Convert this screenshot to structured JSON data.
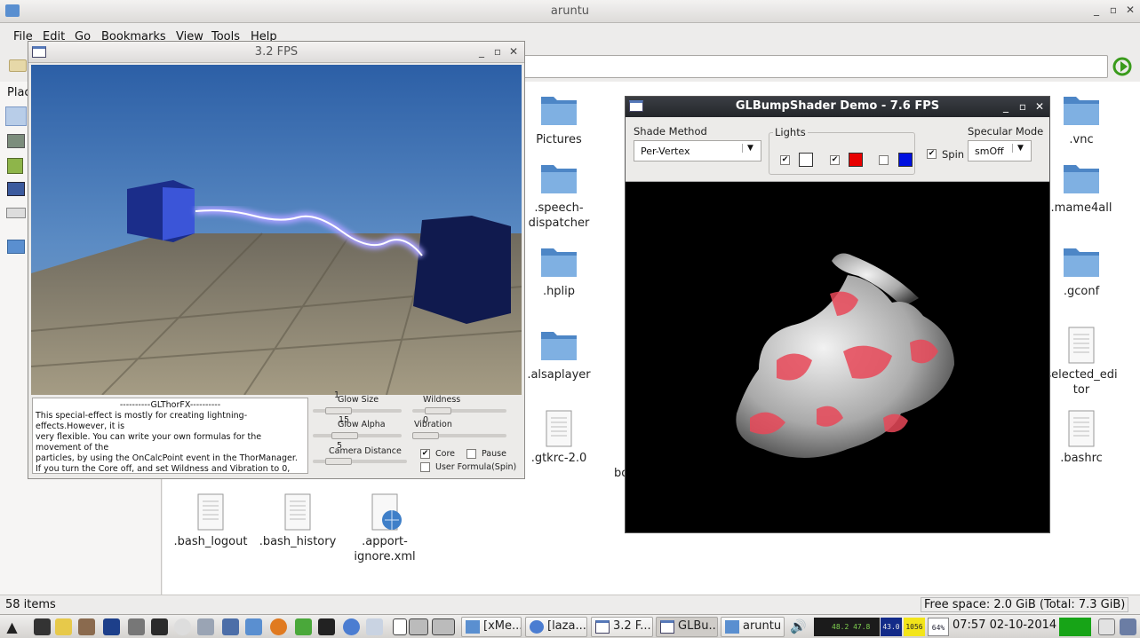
{
  "file_manager": {
    "title": "aruntu",
    "menu": [
      "File",
      "Edit",
      "Go",
      "Bookmarks",
      "View",
      "Tools",
      "Help"
    ],
    "side_pane_label": "Plac",
    "files_col1": [
      "Pictures",
      ".speech-\ndispatcher",
      ".hplip",
      ".alsaplayer",
      ".gtkrc-2.0"
    ],
    "files_right": [
      ".vnc",
      ".mame4all",
      ".gconf",
      "selected_edi\ntor",
      ".bashrc"
    ],
    "files_bottom": [
      ".bash_logout",
      ".bash_history",
      ".apport-\nignore.xml"
    ],
    "hidden_label_partial": "bo",
    "status_items": "58 items",
    "status_free": "Free space: 2.0 GiB (Total: 7.3 GiB)"
  },
  "thor_window": {
    "title": "3.2 FPS",
    "description_lines": [
      "----------GLThorFX----------",
      "This special-effect is mostly for creating lightning-effects.However, it is",
      "very flexible. You can write your own formulas for the movement of the",
      "particles, by using the OnCalcPoint event in the ThorManager.",
      "If you turn the Core off, and set Wildness and Vibration to 0,"
    ],
    "glow_size_label": "Glow Size",
    "glow_size_value": "15",
    "glow_size_tick": "1",
    "wildness_label": "Wildness",
    "wildness_value": "0",
    "glow_alpha_label": "Glow Alpha",
    "vibration_label": "Vibration",
    "camera_distance_label": "Camera Distance",
    "camera_distance_value": "5",
    "core_label": "Core",
    "pause_label": "Pause",
    "user_formula_label": "User Formula(Spin)"
  },
  "bump_window": {
    "title": "GLBumpShader Demo - 7.6 FPS",
    "shade_method_label": "Shade Method",
    "shade_method_value": "Per-Vertex",
    "lights_label": "Lights",
    "spin_label": "Spin",
    "specular_mode_label": "Specular Mode",
    "specular_mode_value": "smOff",
    "light_colors": [
      "#ffffff",
      "#e80000",
      "#0010e0"
    ]
  },
  "taskbar": {
    "tasks": [
      "[xMe...",
      "[laza...",
      "3.2 F...",
      "GLBu...",
      "aruntu"
    ],
    "meters": [
      "48.2",
      "47.8",
      "43.0",
      "1056",
      "64%"
    ],
    "clock": "07:57 02-10-2014"
  }
}
